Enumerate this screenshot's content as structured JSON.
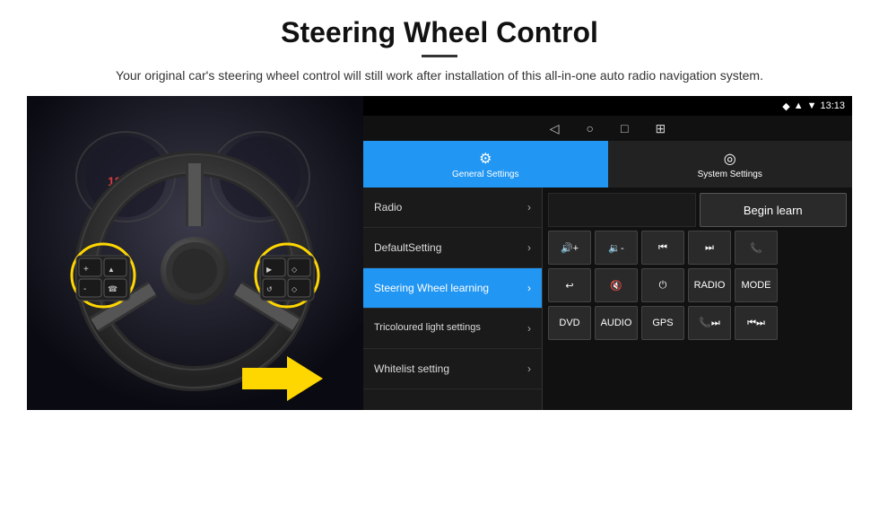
{
  "header": {
    "title": "Steering Wheel Control",
    "subtitle": "Your original car's steering wheel control will still work after installation of this all-in-one auto radio navigation system."
  },
  "status_bar": {
    "signal_icon": "▲",
    "wifi_icon": "▼",
    "time": "13:13",
    "location_icon": "◆"
  },
  "nav_bar": {
    "back": "◁",
    "home": "○",
    "recent": "□",
    "menu": "⊞"
  },
  "tabs": [
    {
      "id": "general",
      "label": "General Settings",
      "icon": "⚙",
      "active": true
    },
    {
      "id": "system",
      "label": "System Settings",
      "icon": "◎",
      "active": false
    }
  ],
  "menu_items": [
    {
      "id": "radio",
      "label": "Radio",
      "active": false
    },
    {
      "id": "default",
      "label": "DefaultSetting",
      "active": false
    },
    {
      "id": "steering",
      "label": "Steering Wheel learning",
      "active": true
    },
    {
      "id": "tricoloured",
      "label": "Tricoloured light settings",
      "active": false,
      "multiline": true
    },
    {
      "id": "whitelist",
      "label": "Whitelist setting",
      "active": false
    }
  ],
  "controls": {
    "begin_learn": "Begin learn",
    "row1": [
      "▶◀+",
      "▶◀-",
      "⏮",
      "⏭",
      "☎"
    ],
    "row2": [
      "↩",
      "🔇",
      "⏻",
      "RADIO",
      "MODE"
    ],
    "row3": [
      "DVD",
      "AUDIO",
      "GPS",
      "☎⏭",
      "⏮⏭"
    ]
  }
}
